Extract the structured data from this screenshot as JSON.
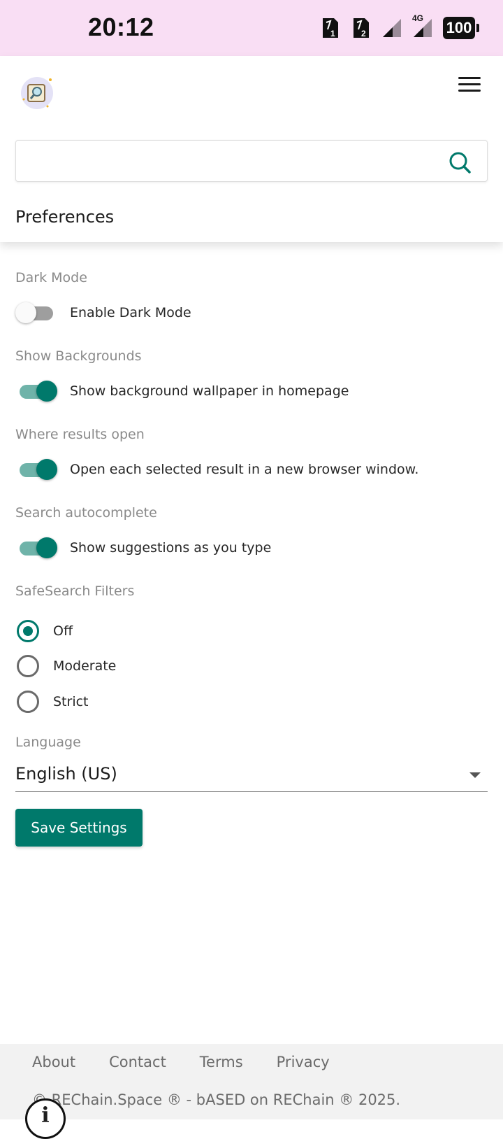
{
  "status_bar": {
    "time": "20:12",
    "sim1_label": "1",
    "sim2_label": "2",
    "network_label": "4G",
    "battery_level": "100"
  },
  "header": {
    "logo_icon": "magnifier-frame-icon",
    "menu_icon": "hamburger-menu-icon",
    "search": {
      "value": "",
      "placeholder": ""
    },
    "title": "Preferences"
  },
  "settings": {
    "dark_mode": {
      "label": "Dark Mode",
      "toggle_label": "Enable Dark Mode",
      "enabled": false
    },
    "backgrounds": {
      "label": "Show Backgrounds",
      "toggle_label": "Show background wallpaper in homepage",
      "enabled": true
    },
    "results_open": {
      "label": "Where results open",
      "toggle_label": "Open each selected result in a new browser window.",
      "enabled": true
    },
    "autocomplete": {
      "label": "Search autocomplete",
      "toggle_label": "Show suggestions as you type",
      "enabled": true
    },
    "safesearch": {
      "label": "SafeSearch Filters",
      "options": [
        "Off",
        "Moderate",
        "Strict"
      ],
      "selected": "Off"
    },
    "language": {
      "label": "Language",
      "value": "English (US)"
    },
    "save_label": "Save Settings"
  },
  "footer": {
    "links": [
      "About",
      "Contact",
      "Terms",
      "Privacy"
    ],
    "copyright": "© REChain.Space ® - bASED on REChain ® 2025."
  },
  "colors": {
    "accent": "#00796b",
    "status_bar_bg": "#f9def4",
    "footer_bg": "#f2f2f2"
  }
}
